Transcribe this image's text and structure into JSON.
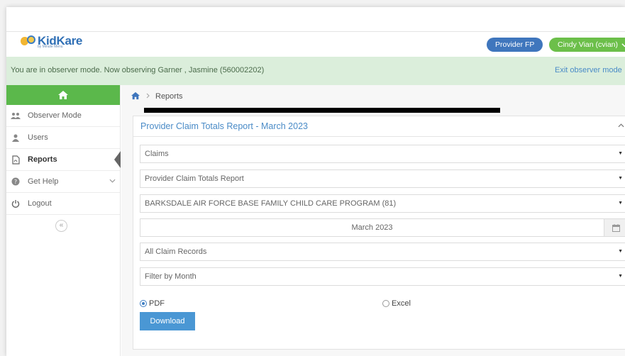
{
  "header": {
    "logo_text": "KidKare",
    "logo_sub": "by Minute Menu",
    "provider_button": "Provider FP",
    "user_button": "Cindy Vian (cvian)"
  },
  "observer": {
    "message": "You are in observer mode. Now observing Garner , Jasmine (560002202)",
    "exit_link": "Exit observer mode"
  },
  "sidebar": {
    "items": [
      {
        "label": "Observer Mode",
        "icon": "users-group-icon"
      },
      {
        "label": "Users",
        "icon": "user-icon"
      },
      {
        "label": "Reports",
        "icon": "pdf-file-icon",
        "active": true
      },
      {
        "label": "Get Help",
        "icon": "question-circle-icon"
      },
      {
        "label": "Logout",
        "icon": "power-icon"
      }
    ],
    "collapse_label": "«"
  },
  "breadcrumb": {
    "current": "Reports"
  },
  "panel": {
    "title": "Provider Claim Totals Report - March 2023",
    "claims_select": "Claims",
    "report_select": "Provider Claim Totals Report",
    "program_select": "BARKSDALE AIR FORCE BASE FAMILY CHILD CARE PROGRAM (81)",
    "month_value": "March 2023",
    "records_select": "All Claim Records",
    "filter_select": "Filter by Month",
    "format_pdf": "PDF",
    "format_excel": "Excel",
    "selected_format": "PDF",
    "download_label": "Download"
  },
  "colors": {
    "brand_blue": "#3f76bd",
    "brand_green": "#5bb84b",
    "observer_bg": "#dbeedb",
    "link_blue": "#4a8bc7"
  }
}
